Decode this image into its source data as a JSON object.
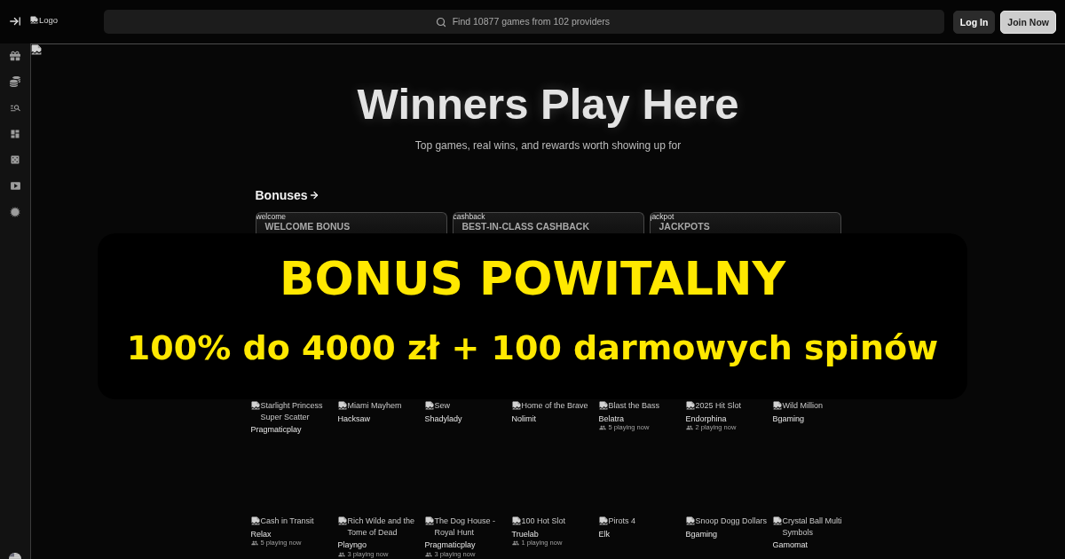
{
  "top_bar": {
    "logo_alt": "Logo",
    "search": {
      "placeholder": "Find 10877 games from 102 providers"
    },
    "buttons": [
      {
        "label": "Log In",
        "kind": "secondary"
      },
      {
        "label": "Join Now",
        "kind": "primary"
      }
    ]
  },
  "hero": {
    "title": "Winners Play Here",
    "subtitle": "Top games, real wins, and rewards worth showing up for"
  },
  "bonuses": {
    "heading": "Bonuses",
    "cards": [
      {
        "image_alt": "welcome",
        "title": "WELCOME BONUS"
      },
      {
        "image_alt": "cashback",
        "title": "BEST-IN-CLASS CASHBACK"
      },
      {
        "image_alt": "jackpot",
        "title": "JACKPOTS"
      }
    ]
  },
  "promo_banner": {
    "headline": "BONUS POWITALNY",
    "offer": "100% do 4000 zł + 100 darmowych spinów"
  },
  "games": [
    {
      "title": "Starlight Princess Super Scatter",
      "provider": "Pragmaticplay"
    },
    {
      "title": "Miami Mayhem",
      "provider": "Hacksaw"
    },
    {
      "title": "Sew",
      "provider": "Shadylady"
    },
    {
      "title": "Home of the Brave",
      "provider": "Nolimit"
    },
    {
      "title": "Blast the Bass",
      "provider": "Belatra",
      "players": "5 playing now"
    },
    {
      "title": "2025 Hit Slot",
      "provider": "Endorphina",
      "players": "2 playing now"
    },
    {
      "title": "Wild Million",
      "provider": "Bgaming"
    },
    {
      "title": "Cash in Transit",
      "provider": "Relax",
      "players": "5 playing now"
    },
    {
      "title": "Rich Wilde and the Tome of Dead",
      "provider": "Playngo",
      "players": "3 playing now"
    },
    {
      "title": "The Dog House - Royal Hunt",
      "provider": "Pragmaticplay",
      "players": "3 playing now"
    },
    {
      "title": "100 Hot Slot",
      "provider": "Truelab",
      "players": "1 playing now"
    },
    {
      "title": "Pirots 4",
      "provider": "Elk"
    },
    {
      "title": "Snoop Dogg Dollars",
      "provider": "Bgaming"
    },
    {
      "title": "Crystal Ball Multi Symbols",
      "provider": "Gamomat"
    }
  ]
}
